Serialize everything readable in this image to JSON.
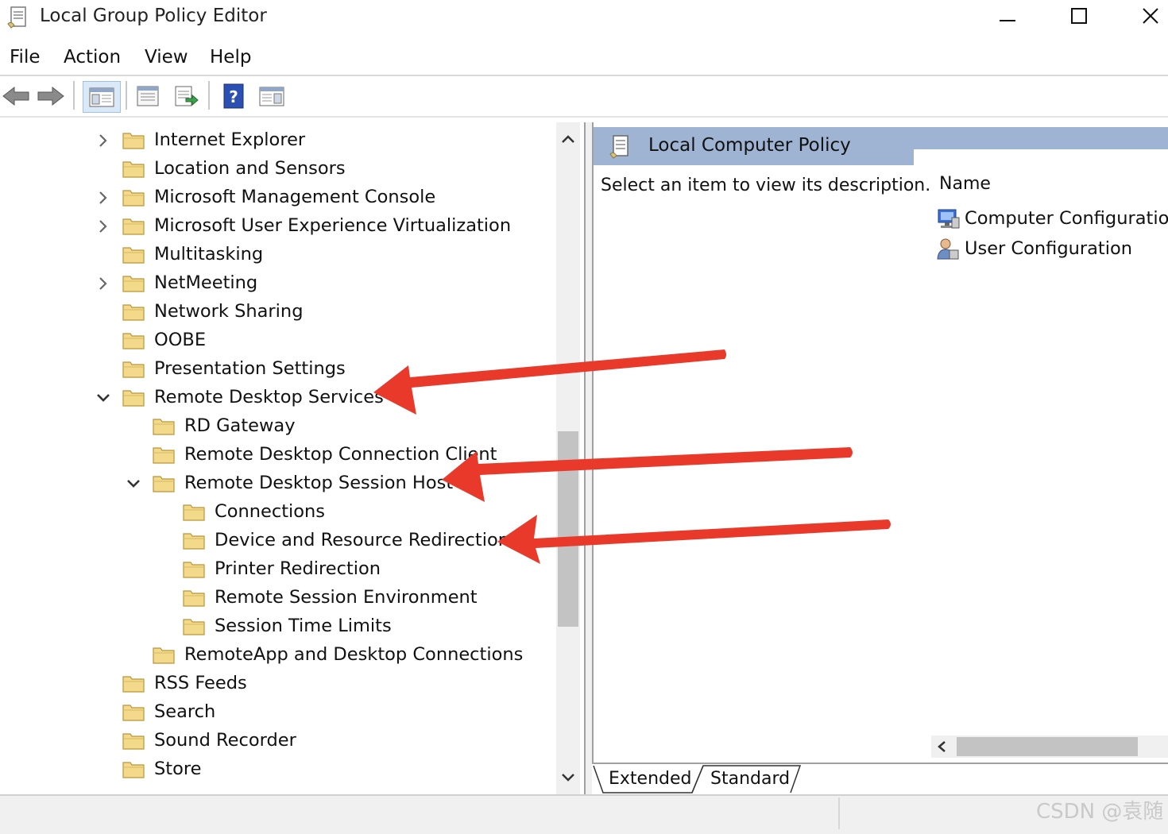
{
  "window": {
    "title": "Local Group Policy Editor"
  },
  "menu": [
    "File",
    "Action",
    "View",
    "Help"
  ],
  "tree": {
    "items": [
      {
        "label": "Internet Explorer",
        "expander": "collapsed"
      },
      {
        "label": "Location and Sensors",
        "expander": "none"
      },
      {
        "label": "Microsoft Management Console",
        "expander": "collapsed"
      },
      {
        "label": "Microsoft User Experience Virtualization",
        "expander": "collapsed"
      },
      {
        "label": "Multitasking",
        "expander": "none"
      },
      {
        "label": "NetMeeting",
        "expander": "collapsed"
      },
      {
        "label": "Network Sharing",
        "expander": "none"
      },
      {
        "label": "OOBE",
        "expander": "none"
      },
      {
        "label": "Presentation Settings",
        "expander": "none"
      },
      {
        "label": "Remote Desktop Services",
        "expander": "expanded"
      },
      {
        "label": "RD Gateway",
        "expander": "none"
      },
      {
        "label": "Remote Desktop Connection Client",
        "expander": "none"
      },
      {
        "label": "Remote Desktop Session Host",
        "expander": "expanded"
      },
      {
        "label": "Connections",
        "expander": "none"
      },
      {
        "label": "Device and Resource Redirection",
        "expander": "none"
      },
      {
        "label": "Printer Redirection",
        "expander": "none"
      },
      {
        "label": "Remote Session Environment",
        "expander": "none"
      },
      {
        "label": "Session Time Limits",
        "expander": "none"
      },
      {
        "label": "RemoteApp and Desktop Connections",
        "expander": "none"
      },
      {
        "label": "RSS Feeds",
        "expander": "none"
      },
      {
        "label": "Search",
        "expander": "none"
      },
      {
        "label": "Sound Recorder",
        "expander": "none"
      },
      {
        "label": "Store",
        "expander": "none"
      }
    ]
  },
  "right_pane": {
    "header": "Local Computer Policy",
    "description": "Select an item to view its description.",
    "column_header": "Name",
    "items": [
      {
        "label": "Computer Configuration",
        "icon": "computer-config-icon"
      },
      {
        "label": "User Configuration",
        "icon": "user-config-icon"
      }
    ]
  },
  "tabs": [
    "Extended",
    "Standard"
  ],
  "watermark": "CSDN @袁随",
  "colors": {
    "header_bg": "#9eb4d2",
    "arrow": "#e8392a",
    "folder": "#f3d98a"
  }
}
